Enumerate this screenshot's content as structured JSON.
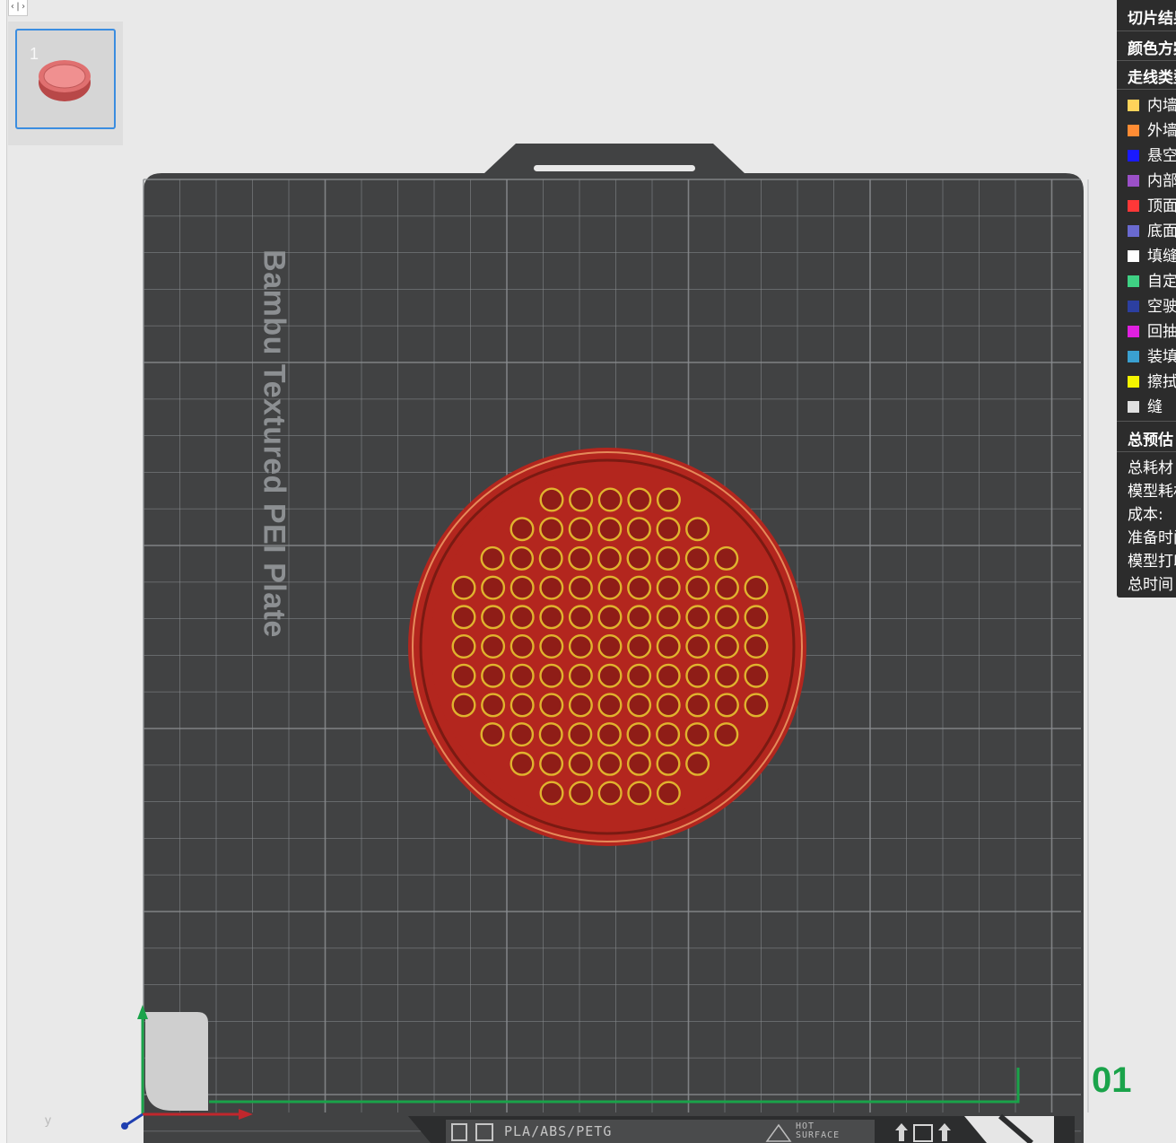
{
  "toolbar": {
    "collapse_glyph": "‹|›"
  },
  "plate_list": {
    "items": [
      {
        "number": "1"
      }
    ]
  },
  "plate": {
    "brand_label": "Bambu Textured PEI Plate",
    "plate_number": "01",
    "strip_material": "PLA/ABS/PETG",
    "strip_hot_line1": "HOT",
    "strip_hot_line2": "SURFACE",
    "axis_y_label": "y",
    "colors": {
      "bed": "#414243",
      "grid": "#8a8d90",
      "print": "#b3261e",
      "wall": "#e0b32e",
      "x_axis": "#c0272d",
      "y_axis": "#1aa34a",
      "z_axis": "#1f3fb0",
      "extent": "#1aa34a"
    }
  },
  "legend": {
    "title": "切片结果",
    "scheme_label": "颜色方案",
    "line_type_label": "走线类型",
    "items": [
      {
        "label": "内墙",
        "color": "#ffd35a"
      },
      {
        "label": "外墙",
        "color": "#ff8c34"
      },
      {
        "label": "悬空",
        "color": "#1a1aff"
      },
      {
        "label": "内部实心填充",
        "color": "#9b50c8"
      },
      {
        "label": "顶面",
        "color": "#ff3838"
      },
      {
        "label": "底面",
        "color": "#6a6ad0"
      },
      {
        "label": "填缝",
        "color": "#ffffff"
      },
      {
        "label": "自定义",
        "color": "#3fd184"
      },
      {
        "label": "空驶",
        "color": "#2c3fa0"
      },
      {
        "label": "回抽",
        "color": "#e020e0"
      },
      {
        "label": "装填",
        "color": "#3aa0d0"
      },
      {
        "label": "擦拭",
        "color": "#f5f500"
      },
      {
        "label": "缝",
        "color": "#e0e0e0"
      }
    ],
    "estimate_title": "总预估",
    "stats": [
      {
        "label": "总耗材"
      },
      {
        "label": "模型耗材"
      },
      {
        "label": "成本:"
      },
      {
        "label": "准备时间"
      },
      {
        "label": "模型打印时间"
      },
      {
        "label": "总时间"
      }
    ]
  }
}
